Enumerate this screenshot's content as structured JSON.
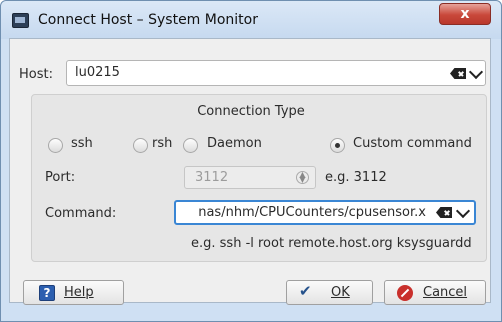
{
  "window": {
    "title": "Connect Host – System Monitor",
    "close_glyph": "x"
  },
  "host": {
    "label": "Host:",
    "value": "lu0215"
  },
  "connection": {
    "title": "Connection Type",
    "options": [
      {
        "label": "ssh",
        "checked": false
      },
      {
        "label": "rsh",
        "checked": false
      },
      {
        "label": "Daemon",
        "checked": false
      },
      {
        "label": "Custom command",
        "checked": true
      }
    ]
  },
  "port": {
    "label": "Port:",
    "value": "3112",
    "example": "e.g. 3112"
  },
  "command": {
    "label": "Command:",
    "value": "nas/nhm/CPUCounters/cpusensor.x",
    "example": "e.g. ssh -l root remote.host.org ksysguardd"
  },
  "buttons": {
    "help": "Help",
    "ok": "OK",
    "cancel": "Cancel"
  },
  "icons": {
    "help": "help-icon",
    "ok": "check-icon",
    "cancel": "cancel-icon",
    "clear": "clear-text-icon",
    "dropdown": "chevron-down-icon"
  }
}
